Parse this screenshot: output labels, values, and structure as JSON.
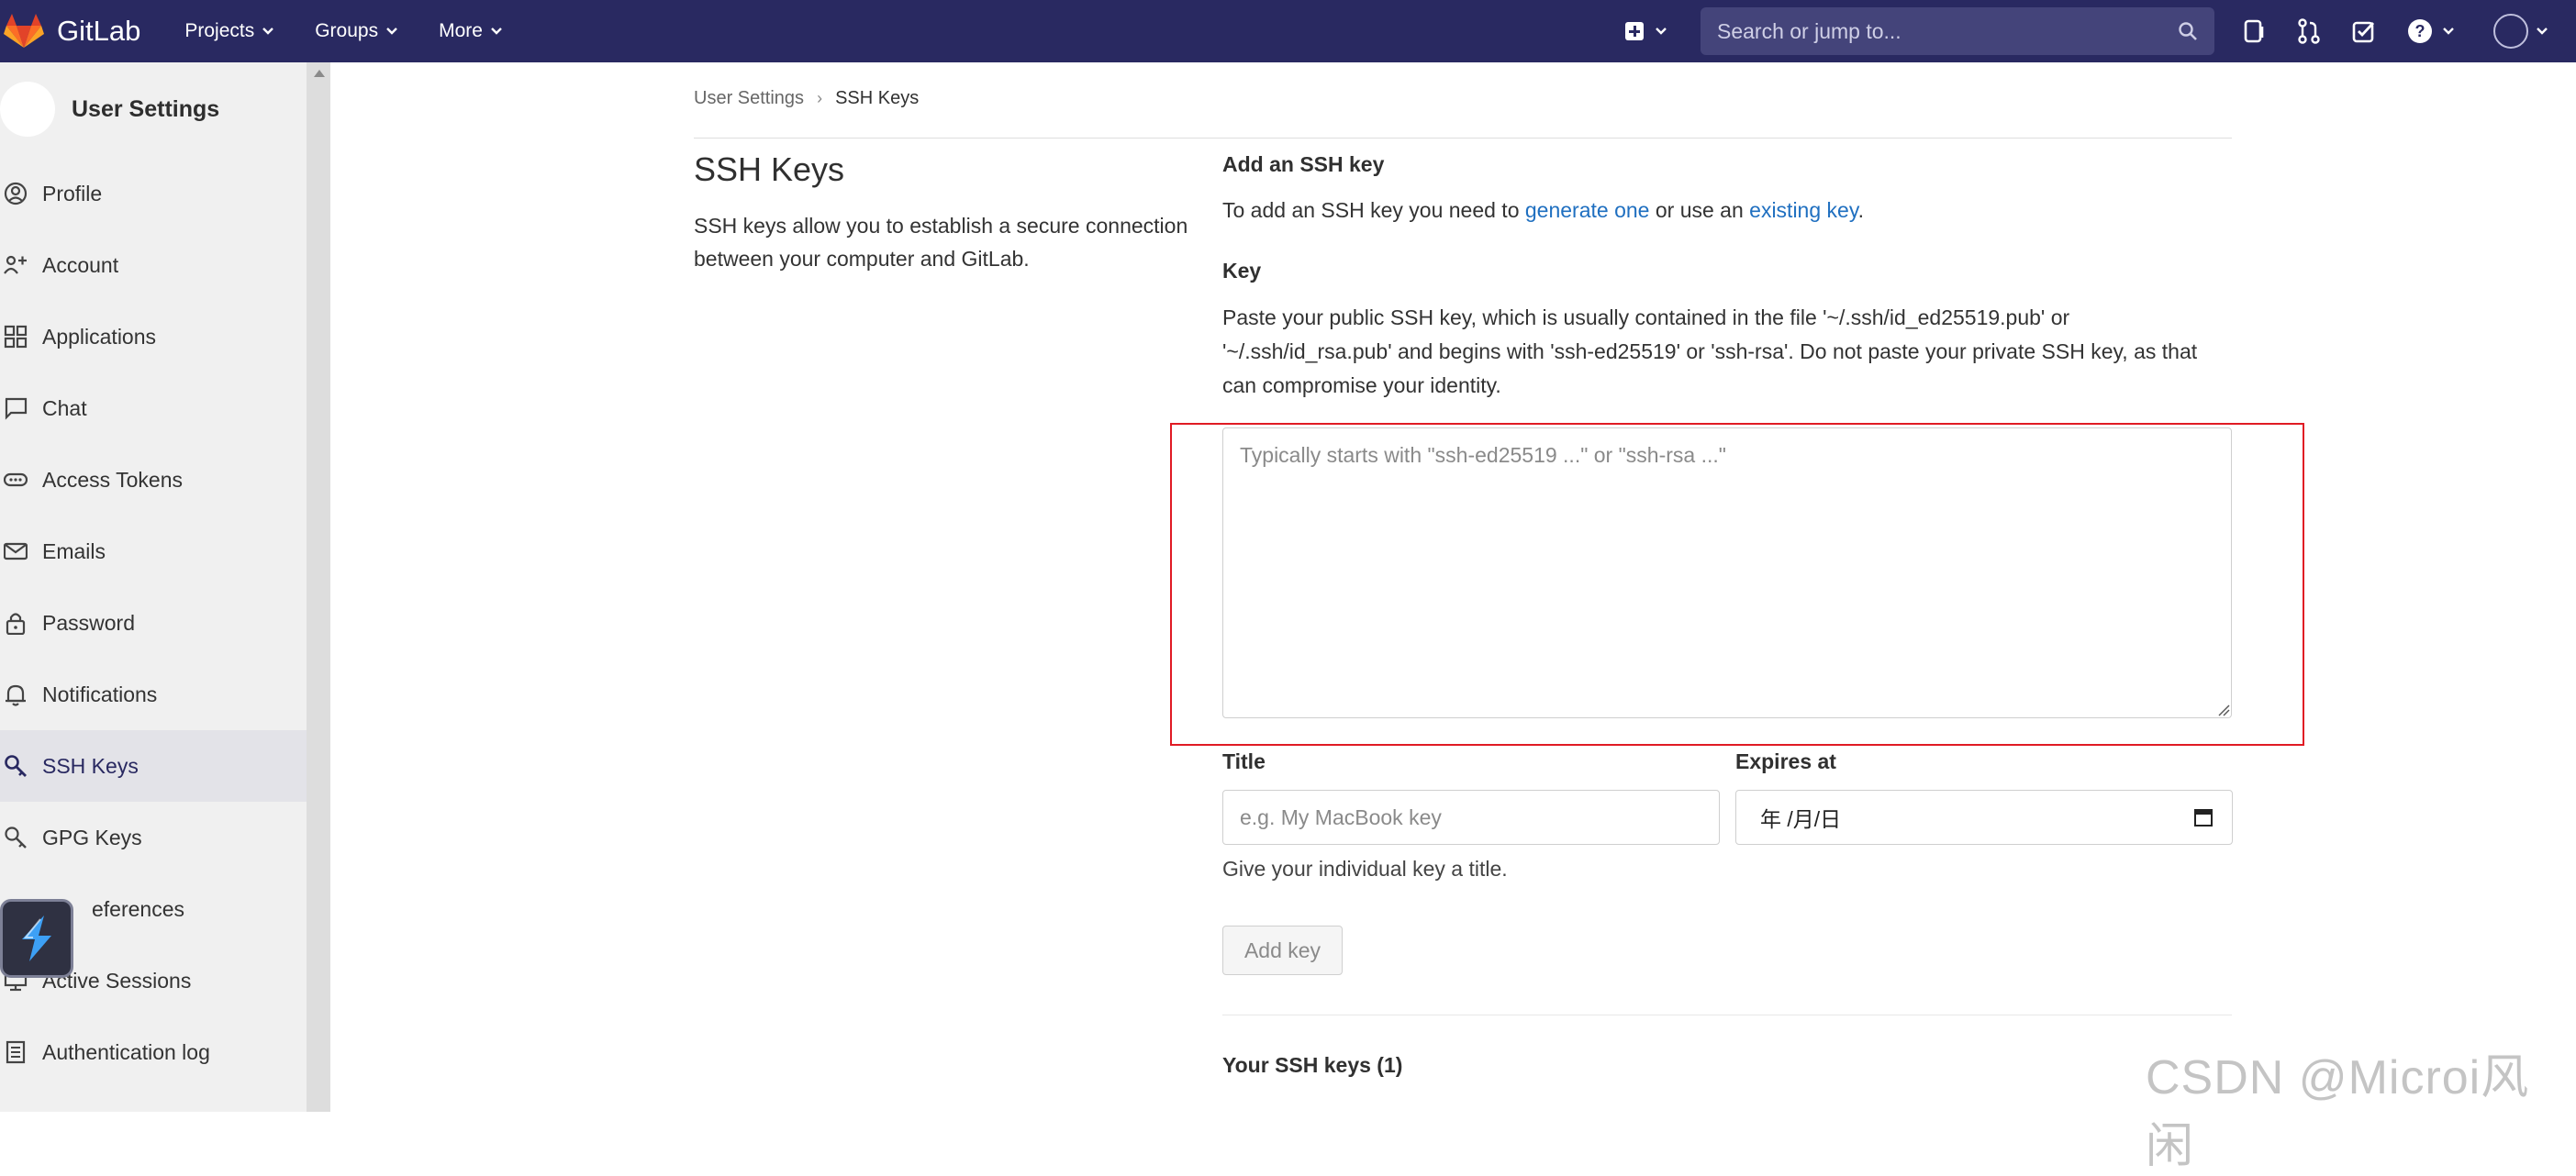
{
  "topnav": {
    "brand": "GitLab",
    "items": [
      "Projects",
      "Groups",
      "More"
    ],
    "search_placeholder": "Search or jump to...",
    "colors": {
      "bar": "#292961",
      "search": "#44447a"
    }
  },
  "sidebar": {
    "title": "User Settings",
    "items": [
      {
        "label": "Profile",
        "icon": "profile-icon"
      },
      {
        "label": "Account",
        "icon": "account-icon"
      },
      {
        "label": "Applications",
        "icon": "applications-icon"
      },
      {
        "label": "Chat",
        "icon": "chat-icon"
      },
      {
        "label": "Access Tokens",
        "icon": "token-icon"
      },
      {
        "label": "Emails",
        "icon": "mail-icon"
      },
      {
        "label": "Password",
        "icon": "lock-icon"
      },
      {
        "label": "Notifications",
        "icon": "bell-icon"
      },
      {
        "label": "SSH Keys",
        "icon": "key-icon",
        "active": true
      },
      {
        "label": "GPG Keys",
        "icon": "key-icon"
      },
      {
        "label": "eferences",
        "icon": "app-badge-icon"
      },
      {
        "label": "Active Sessions",
        "icon": "monitor-icon"
      },
      {
        "label": "Authentication log",
        "icon": "log-icon"
      }
    ]
  },
  "breadcrumb": {
    "parent": "User Settings",
    "current": "SSH Keys"
  },
  "main": {
    "title": "SSH Keys",
    "description": "SSH keys allow you to establish a secure connection between your computer and GitLab.",
    "add_title": "Add an SSH key",
    "add_desc_prefix": "To add an SSH key you need to ",
    "add_desc_link1": "generate one",
    "add_desc_middle": " or use an ",
    "add_desc_link2": "existing key",
    "add_desc_suffix": ".",
    "key_label": "Key",
    "key_help": "Paste your public SSH key, which is usually contained in the file '~/.ssh/id_ed25519.pub' or '~/.ssh/id_rsa.pub' and begins with 'ssh-ed25519' or 'ssh-rsa'. Do not paste your private SSH key, as that can compromise your identity.",
    "key_placeholder": "Typically starts with \"ssh-ed25519 ...\" or \"ssh-rsa ...\"",
    "title_label": "Title",
    "title_placeholder": "e.g. My MacBook key",
    "expires_label": "Expires at",
    "expires_value": "年 /月/日",
    "title_help": "Give your individual key a title.",
    "add_button": "Add key",
    "your_keys": "Your SSH keys (1)"
  },
  "watermark": "CSDN @Microi风闲",
  "colors": {
    "link": "#1f6fc0",
    "highlight": "#e01b24"
  }
}
